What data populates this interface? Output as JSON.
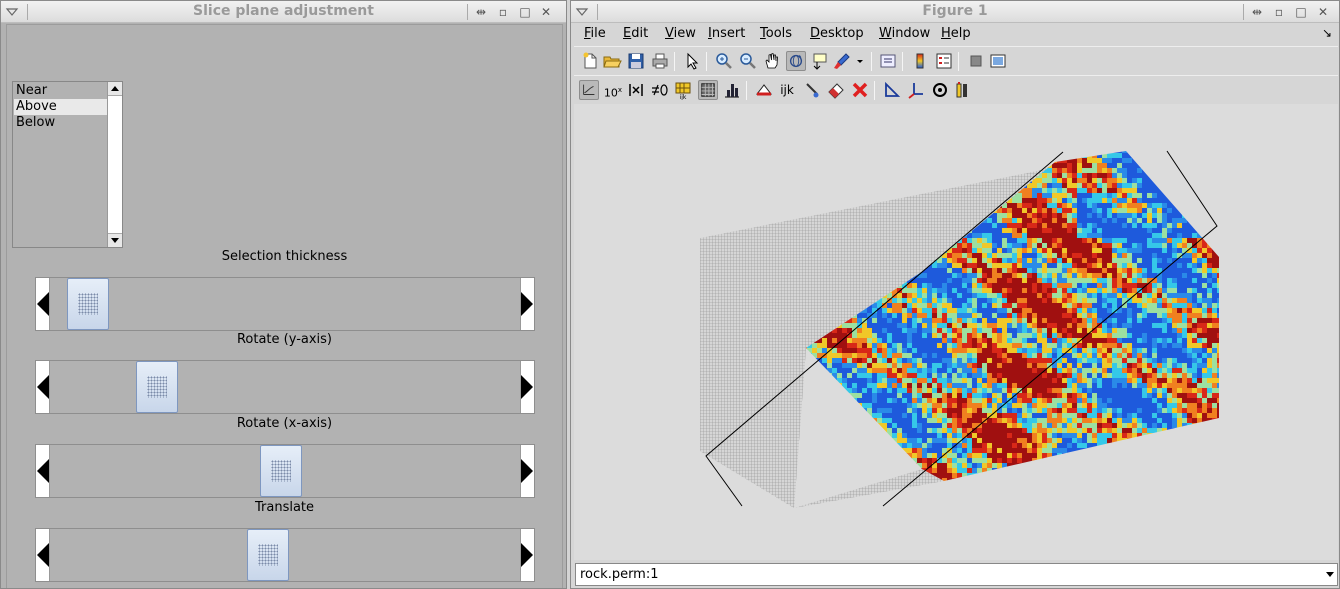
{
  "left_window": {
    "title": "Slice plane adjustment",
    "list": {
      "items": [
        "Near",
        "Above",
        "Below"
      ],
      "selected": "Above"
    },
    "sliders": [
      {
        "label": "Selection thickness",
        "value": 0.04
      },
      {
        "label": "Rotate (y-axis)",
        "value": 0.2
      },
      {
        "label": "Rotate (x-axis)",
        "value": 0.49
      },
      {
        "label": "Translate",
        "value": 0.46
      }
    ]
  },
  "right_window": {
    "title": "Figure 1",
    "menus": [
      {
        "u": "F",
        "rest": "ile"
      },
      {
        "u": "E",
        "rest": "dit"
      },
      {
        "u": "V",
        "rest": "iew"
      },
      {
        "u": "I",
        "rest": "nsert"
      },
      {
        "u": "T",
        "rest": "ools"
      },
      {
        "u": "D",
        "rest": "esktop"
      },
      {
        "u": "W",
        "rest": "indow"
      },
      {
        "u": "H",
        "rest": "elp"
      }
    ],
    "toolbar2_text": {
      "pow10": "10",
      "ijk": "ijk"
    },
    "popup_value": "rock.perm:1"
  },
  "colors": {
    "grid_gray": "#8f8f8f",
    "jet_blue": "#1e5adc",
    "jet_cyan": "#35c8e8",
    "jet_yellow": "#f0c828",
    "jet_red": "#d82818"
  }
}
